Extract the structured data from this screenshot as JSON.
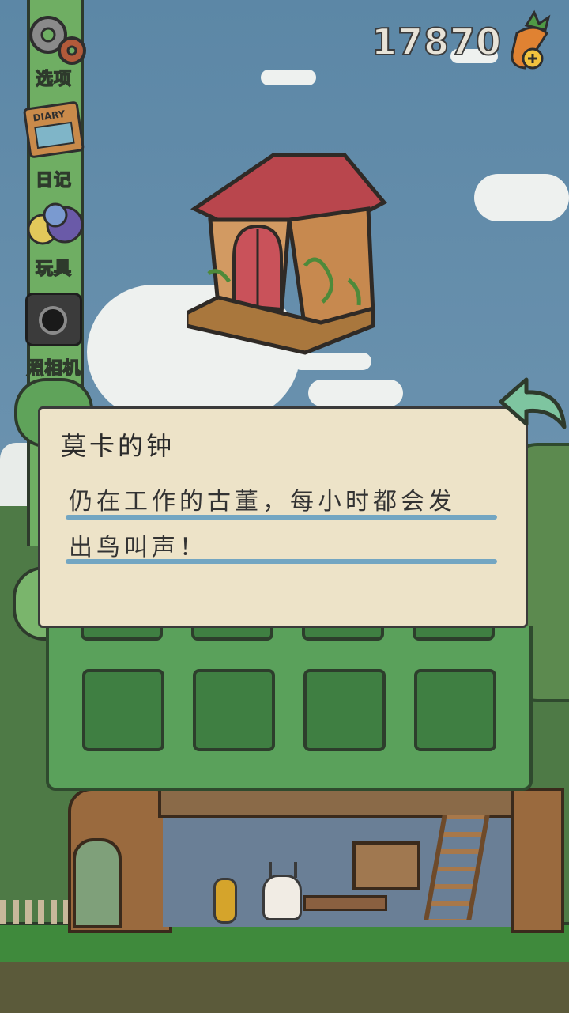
{
  "hud": {
    "carrot_count": "17870",
    "carrot_icon": "carrot-plus-icon"
  },
  "sidebar": {
    "items": [
      {
        "label": "选项",
        "icon": "gear-icon"
      },
      {
        "label": "日记",
        "icon": "diary-icon"
      },
      {
        "label": "玩具",
        "icon": "toy-ball-icon"
      },
      {
        "label": "照相机",
        "icon": "camera-icon"
      }
    ],
    "diary_cover_text": "DIARY"
  },
  "item_detail": {
    "title": "莫卡的钟",
    "description_line1": "仍在工作的古董，每小时都会发",
    "description_line2": "出鸟叫声！",
    "item_icon": "birdhouse-clock-icon"
  },
  "colors": {
    "dialog_bg": "#ede3c8",
    "rule": "#73a6c2",
    "inventory_bg": "#5aa15b",
    "slot": "#3f7f42",
    "sidebar_green": "#6fae63"
  }
}
